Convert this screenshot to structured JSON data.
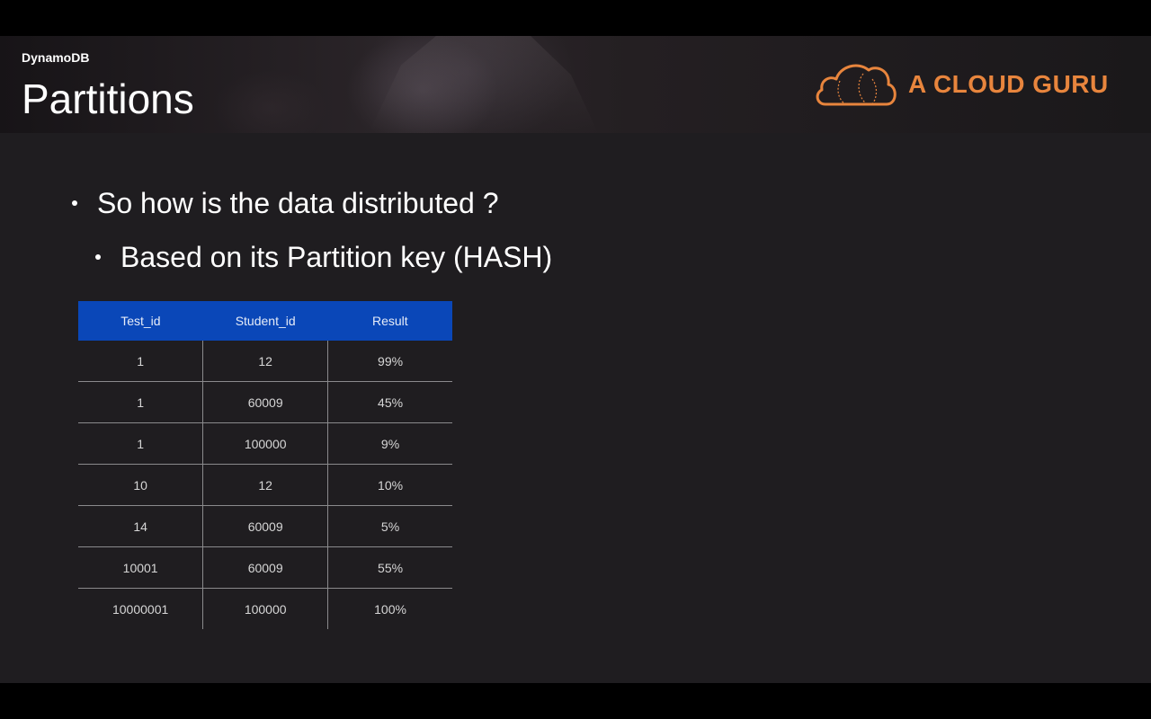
{
  "header": {
    "subject": "DynamoDB",
    "title": "Partitions",
    "logo_text": "A CLOUD GURU",
    "logo_icon": "cloud-icon",
    "accent_color": "#e8853d"
  },
  "content": {
    "bullets": [
      "So how is the data distributed ?",
      "Based on its Partition key (HASH)"
    ]
  },
  "table": {
    "header_color": "#0a47b8",
    "columns": [
      "Test_id",
      "Student_id",
      "Result"
    ],
    "rows": [
      [
        "1",
        "12",
        "99%"
      ],
      [
        "1",
        "60009",
        "45%"
      ],
      [
        "1",
        "100000",
        "9%"
      ],
      [
        "10",
        "12",
        "10%"
      ],
      [
        "14",
        "60009",
        "5%"
      ],
      [
        "10001",
        "60009",
        "55%"
      ],
      [
        "10000001",
        "100000",
        "100%"
      ]
    ]
  }
}
